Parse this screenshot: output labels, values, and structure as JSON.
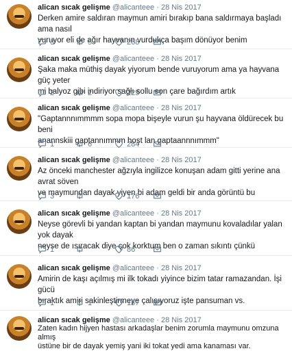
{
  "colors": {
    "text": "#14171a",
    "muted": "#657786",
    "divider": "#e6ecf0"
  },
  "tweets": [
    {
      "name": "alican sıcak gelişme",
      "handle": "@alicanteee",
      "date": "28 Nis 2017",
      "lines": [
        "Derken amire saldıran maymun amiri bırakıp bana saldırmaya başladı ama nasıl",
        "vuruyor eli de ağır hayvanın vurdukça başım dönüyor benim"
      ],
      "replies": "3",
      "retweets": "5",
      "likes": "268"
    },
    {
      "name": "alican sıcak gelişme",
      "handle": "@alicanteee",
      "date": "28 Nis 2017",
      "lines": [
        "Şaka maka müthiş dayak yiyorum bende vuruyorum ama ya hayvana güç yeter",
        "mi balyoz gibi indiriyor sağlı sollu son çare bağırdım artık"
      ],
      "replies": "2",
      "retweets": "2",
      "likes": "225"
    },
    {
      "name": "alican sıcak gelişme",
      "handle": "@alicanteee",
      "date": "28 Nis 2017",
      "lines": [
        "\"Gaptannnımmmm sopa mopa bişeyle vurun şu hayvana öldürecek bu beni",
        "anannskiii gaptannımmm hoşt lan gaptaannnımmm\""
      ],
      "replies": "1",
      "retweets": "6",
      "likes": "284"
    },
    {
      "name": "alican sıcak gelişme",
      "handle": "@alicanteee",
      "date": "28 Nis 2017",
      "lines": [
        "Az önceki manchester ağzıyla ingilizce konuşan adam gitti yerine ana avrat söven",
        "ve maymundan dayak yiyen bi adam geldi bir anda görüntü bu"
      ],
      "replies": "3",
      "retweets": "",
      "likes": "176"
    },
    {
      "name": "alican sıcak gelişme",
      "handle": "@alicanteee",
      "date": "28 Nis 2017",
      "lines": [
        "Neyse görevli bi yandan kaptan bi yandan maymunu kovaladılar yalan yok dayak",
        "neyse de ısıracak diye çok korktum ben o zaman sıkıntı çünkü"
      ],
      "replies": "1",
      "retweets": "",
      "likes": "86"
    },
    {
      "name": "alican sıcak gelişme",
      "handle": "@alicanteee",
      "date": "28 Nis 2017",
      "lines": [
        "Amirin de kaşı açılmış mi ilk tokadı yiyince bizim tatar ramazandan. İşi gücü",
        "bıraktık amiri sakinleştirmeye çalışıyoruz işte pansuman vs."
      ],
      "replies": "1",
      "retweets": "1",
      "likes": "167"
    },
    {
      "name": "alican sıcak gelişme",
      "handle": "@alicanteee",
      "date": "28 Nis 2017",
      "lines": [
        "Zaten kadın hijyen hastası arkadaşlar benim zorumla maymunu omzuna almış",
        "üstüne bir de dayak yemiş yani iki tokat yedi ama kanaması var."
      ],
      "replies": "",
      "retweets": "",
      "likes": ""
    }
  ]
}
